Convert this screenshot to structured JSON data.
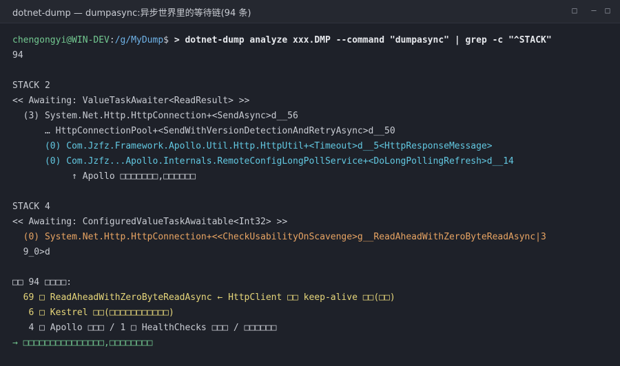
{
  "window": {
    "title": "dotnet-dump — dumpasync:异步世界里的等待链(94 条)",
    "controls": [
      "□",
      "—",
      "□"
    ]
  },
  "terminal": {
    "prompt": {
      "user_host": "chengongyi@WIN-DEV",
      "sep": ":",
      "path": "/g/MyDump",
      "symbol": "$",
      "command": "> dotnet-dump analyze xxx.DMP --command \"dumpasync\" | grep -c \"^STACK\""
    },
    "count_output": "94",
    "stack2": {
      "header": "STACK 2",
      "awaiting": "<< Awaiting: ValueTaskAwaiter<ReadResult> >>",
      "frame1": "  (3) System.Net.Http.HttpConnection+<SendAsync>d__56",
      "frame2": "      … HttpConnectionPool+<SendWithVersionDetectionAndRetryAsync>d__50",
      "frame3": "      (0) Com.Jzfz.Framework.Apollo.Util.Http.HttpUtil+<Timeout>d__5<HttpResponseMessage>",
      "frame4": "      (0) Com.Jzfz...Apollo.Internals.RemoteConfigLongPollService+<DoLongPollingRefresh>d__14",
      "note": "           ↑ Apollo □□□□□□□,□□□□□□"
    },
    "stack4": {
      "header": "STACK 4",
      "awaiting": "<< Awaiting: ConfiguredValueTaskAwaitable<Int32> >>",
      "frame1a": "  (0) System.Net.Http.HttpConnection+<<CheckUsabilityOnScavenge>g__ReadAheadWithZeroByteReadAsync|3",
      "frame1b": "  9_0>d"
    },
    "summary": {
      "header": "□□ 94 □□□□:",
      "item1": "  69 □ ReadAheadWithZeroByteReadAsync ← HttpClient □□ keep-alive □□(□□)",
      "item2": "   6 □ Kestrel □□(□□□□□□□□□□□)",
      "item3": "   4 □ Apollo □□□ / 1 □ HealthChecks □□□ / □□□□□□",
      "conclusion": "→ □□□□□□□□□□□□□□□,□□□□□□□□"
    }
  },
  "colors": {
    "background": "#1e2129",
    "user": "#73c991",
    "path": "#6fb3e8",
    "cyan": "#62c7e0",
    "orange": "#e8a463",
    "yellow": "#e6d67a",
    "green": "#73c991"
  }
}
